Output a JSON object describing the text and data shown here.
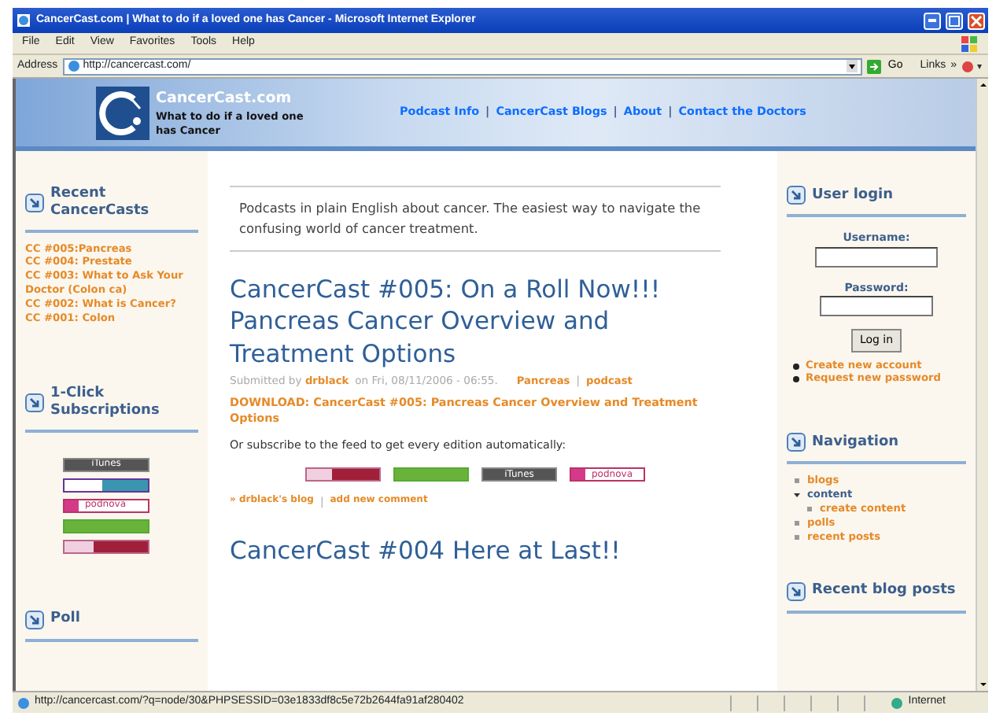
{
  "window": {
    "title": "CancerCast.com | What to do if a loved one has Cancer - Microsoft Internet Explorer",
    "menu": [
      "File",
      "Edit",
      "View",
      "Favorites",
      "Tools",
      "Help"
    ],
    "address_label": "Address",
    "url": "http://cancercast.com/",
    "go": "Go",
    "links": "Links",
    "more": "»"
  },
  "site": {
    "name": "CancerCast.com",
    "tagline": "What to do if a loved one has Cancer",
    "nav": [
      "Podcast Info",
      "CancerCast Blogs",
      "About",
      "Contact the Doctors"
    ],
    "nav_separator": "|"
  },
  "left": {
    "recent": {
      "title": "Recent CancerCasts",
      "items": [
        "CC #005:Pancreas",
        "CC #004: Prestate",
        "CC #003: What to Ask Your Doctor (Colon ca)",
        "CC #002: What is Cancer?",
        "CC #001: Colon"
      ]
    },
    "subscriptions": {
      "title": "1-Click Subscriptions",
      "badges": [
        {
          "kind": "itunes",
          "label": "iTunes"
        },
        {
          "kind": "yahoo"
        },
        {
          "kind": "podnova",
          "label": "podnova"
        },
        {
          "kind": "green"
        },
        {
          "kind": "pink"
        }
      ]
    },
    "poll": {
      "title": "Poll"
    }
  },
  "center": {
    "intro": "Podcasts in plain English about cancer. The easiest way to navigate the confusing world of cancer treatment.",
    "post": {
      "title": "CancerCast #005: On a Roll Now!!! Pancreas Cancer Overview and Treatment Options",
      "submitted": "Submitted by",
      "author": "drblack",
      "date": "on Fri, 08/11/2006 - 06:55.",
      "tags": [
        "Pancreas",
        "podcast"
      ],
      "tag_separator": "|",
      "download": "DOWNLOAD: CancerCast #005: Pancreas Cancer Overview and Treatment Options",
      "subscribe": "Or subscribe to the feed to get every edition automatically:",
      "badges": [
        {
          "kind": "pink"
        },
        {
          "kind": "green"
        },
        {
          "kind": "itunes",
          "label": "iTunes"
        },
        {
          "kind": "podnova",
          "label": "podnova"
        }
      ],
      "links": [
        "» drblack's blog",
        "add new comment"
      ],
      "link_separator": "|"
    },
    "next_title": "CancerCast #004 Here at Last!!"
  },
  "right": {
    "login": {
      "title": "User login",
      "username_label": "Username:",
      "password_label": "Password:",
      "button": "Log in",
      "links": [
        "Create new account",
        "Request new password"
      ]
    },
    "navigation": {
      "title": "Navigation",
      "items": [
        {
          "label": "blogs",
          "expanded": false
        },
        {
          "label": "content",
          "expanded": true,
          "children": [
            {
              "label": "create content",
              "expanded": false
            }
          ]
        },
        {
          "label": "polls",
          "expanded": false
        },
        {
          "label": "recent posts",
          "expanded": false
        }
      ]
    },
    "recent_blog": {
      "title": "Recent blog posts"
    }
  },
  "status_bar": {
    "url": "http://cancercast.com/?q=node/30&PHPSESSID=03e1833df8c5e72b2644fa91af280402",
    "zone": "Internet"
  }
}
